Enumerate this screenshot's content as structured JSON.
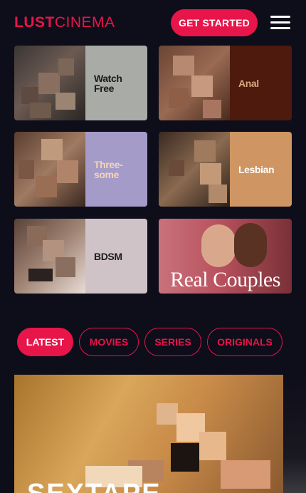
{
  "header": {
    "logo_part1": "LUST",
    "logo_part2": "CINEMA",
    "cta_label": "GET STARTED",
    "menu_icon": "hamburger-menu-icon"
  },
  "categories": [
    {
      "label_line1": "Watch",
      "label_line2": "Free",
      "panel_color": "#a8aba6",
      "label_color": "#1b1b1b"
    },
    {
      "label_line1": "Anal",
      "label_line2": "",
      "panel_color": "#4e1a0e",
      "label_color": "#d9a680"
    },
    {
      "label_line1": "Three-",
      "label_line2": "some",
      "panel_color": "#a59bc8",
      "label_color": "#f2d4b6"
    },
    {
      "label_line1": "Lesbian",
      "label_line2": "",
      "panel_color": "#cf9563",
      "label_color": "#ffffff"
    },
    {
      "label_line1": "BDSM",
      "label_line2": "",
      "panel_color": "#cfc3c8",
      "label_color": "#1b1b1b"
    },
    {
      "label_line1": "Real Couples",
      "label_line2": "",
      "panel_color": "#c7606e",
      "label_color": "#ffffff"
    }
  ],
  "tabs": [
    {
      "label": "LATEST",
      "active": true
    },
    {
      "label": "MOVIES",
      "active": false
    },
    {
      "label": "SERIES",
      "active": false
    },
    {
      "label": "ORIGINALS",
      "active": false
    }
  ],
  "featured": {
    "title": "SEXTAPE"
  },
  "colors": {
    "brand": "#e8154a",
    "background": "#0e0d1a"
  }
}
